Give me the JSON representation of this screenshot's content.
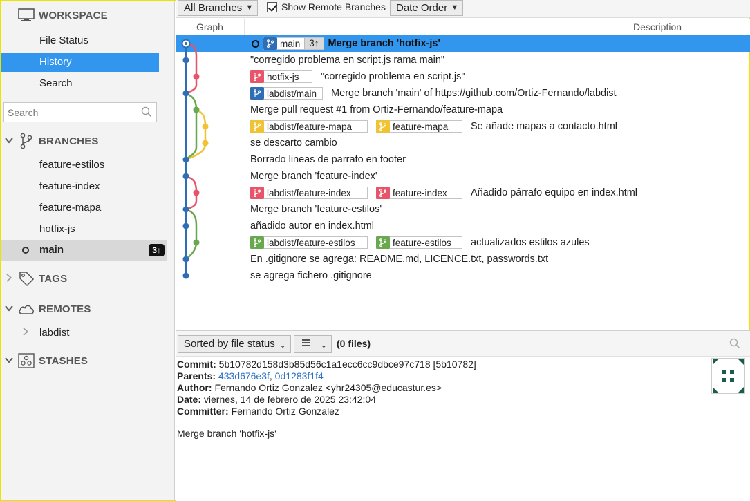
{
  "sidebar": {
    "workspace": {
      "title": "WORKSPACE",
      "items": [
        "File Status",
        "History",
        "Search"
      ]
    },
    "search_placeholder": "Search",
    "branches": {
      "title": "BRANCHES",
      "items": [
        "feature-estilos",
        "feature-index",
        "feature-mapa",
        "hotfix-js",
        "main"
      ],
      "current": "main",
      "current_badge": "3↑"
    },
    "tags": {
      "title": "TAGS"
    },
    "remotes": {
      "title": "REMOTES",
      "items": [
        "labdist"
      ]
    },
    "stashes": {
      "title": "STASHES"
    }
  },
  "toolbar": {
    "branches_filter": "All Branches",
    "show_remote_label": "Show Remote Branches",
    "order": "Date Order"
  },
  "columns": {
    "graph": "Graph",
    "description": "Description"
  },
  "colors": {
    "selection": "#3296ee",
    "main": "#2f6db5",
    "pink": "#e8546a",
    "green": "#6aa84f",
    "yellow": "#f1c232"
  },
  "commits": [
    {
      "refs": [
        {
          "name": "main",
          "count": "3↑",
          "color": "#2f6db5"
        }
      ],
      "message": "Merge branch 'hotfix-js'"
    },
    {
      "refs": [],
      "message": "\"corregido problema en script.js rama main\""
    },
    {
      "refs": [
        {
          "name": "hotfix-js",
          "color": "#e8546a"
        }
      ],
      "message": "\"corregido problema en script.js\""
    },
    {
      "refs": [
        {
          "name": "labdist/main",
          "color": "#2f6db5"
        }
      ],
      "message": "Merge branch 'main' of https://github.com/Ortiz-Fernando/labdist"
    },
    {
      "refs": [],
      "message": "Merge pull request #1 from Ortiz-Fernando/feature-mapa"
    },
    {
      "refs": [
        {
          "name": "labdist/feature-mapa",
          "color": "#f1c232"
        },
        {
          "name": "feature-mapa",
          "color": "#f1c232"
        }
      ],
      "message": "Se añade mapas a contacto.html"
    },
    {
      "refs": [],
      "message": "se descarto cambio"
    },
    {
      "refs": [],
      "message": "Borrado lineas de parrafo en footer"
    },
    {
      "refs": [],
      "message": "Merge branch 'feature-index'"
    },
    {
      "refs": [
        {
          "name": "labdist/feature-index",
          "color": "#e8546a"
        },
        {
          "name": "feature-index",
          "color": "#e8546a"
        }
      ],
      "message": "Añadido párrafo equipo en index.html"
    },
    {
      "refs": [],
      "message": "Merge branch 'feature-estilos'"
    },
    {
      "refs": [],
      "message": "añadido autor en index.html"
    },
    {
      "refs": [
        {
          "name": "labdist/feature-estilos",
          "color": "#6aa84f"
        },
        {
          "name": "feature-estilos",
          "color": "#6aa84f"
        }
      ],
      "message": "actualizados estilos azules"
    },
    {
      "refs": [],
      "message": "En .gitignore se agrega: README.md, LICENCE.txt, passwords.txt"
    },
    {
      "refs": [],
      "message": "se agrega fichero .gitignore"
    }
  ],
  "details": {
    "sort": "Sorted by file status",
    "files": "(0 files)",
    "commit_label": "Commit:",
    "commit": "5b10782d158d3b85d56c1a1ecc6cc9dbce97c718 [5b10782]",
    "parents_label": "Parents:",
    "parent1": "433d676e3f",
    "parent2": "0d1283f1f4",
    "author_label": "Author:",
    "author": "Fernando Ortiz Gonzalez <yhr24305@educastur.es>",
    "date_label": "Date:",
    "date": "viernes, 14 de febrero de 2025 23:42:04",
    "committer_label": "Committer:",
    "committer": "Fernando Ortiz Gonzalez",
    "message": "Merge branch 'hotfix-js'"
  }
}
